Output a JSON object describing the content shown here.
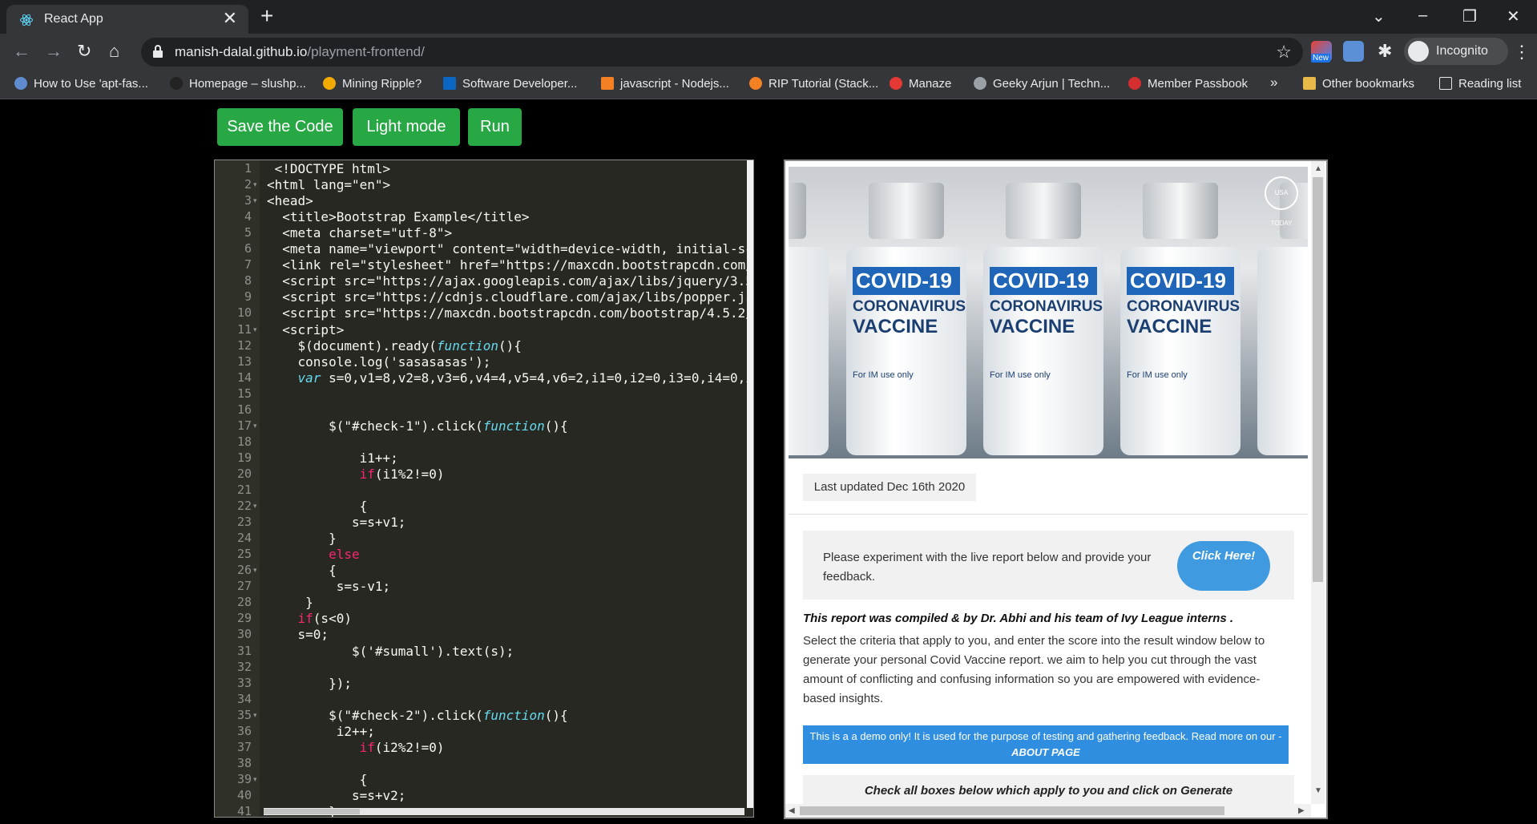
{
  "browser": {
    "tab_title": "React App",
    "url_host": "manish-dalal.github.io",
    "url_path": "/playment-frontend/",
    "incognito_label": "Incognito",
    "extension_badge": "New",
    "bookmarks": [
      "How to Use 'apt-fas...",
      "Homepage – slushp...",
      "Mining Ripple?",
      "Software Developer...",
      "javascript - Nodejs...",
      "RIP Tutorial (Stack...",
      "Manaze",
      "Geeky Arjun | Techn...",
      "Member Passbook"
    ],
    "bookmarks_overflow": "»",
    "other_bookmarks": "Other bookmarks",
    "reading_list": "Reading list"
  },
  "toolbar": {
    "save_label": "Save the Code",
    "light_label": "Light mode",
    "run_label": "Run"
  },
  "editor": {
    "line_numbers": [
      "1",
      "2",
      "3",
      "4",
      "5",
      "6",
      "7",
      "8",
      "9",
      "10",
      "11",
      "12",
      "13",
      "14",
      "15",
      "16",
      "17",
      "18",
      "19",
      "20",
      "21",
      "22",
      "23",
      "24",
      "25",
      "26",
      "27",
      "28",
      "29",
      "30",
      "31",
      "32",
      "33",
      "34",
      "35",
      "36",
      "37",
      "38",
      "39",
      "40",
      "41"
    ],
    "lines": [
      " <!DOCTYPE html>",
      "<html lang=\"en\">",
      "<head>",
      "  <title>Bootstrap Example</title>",
      "  <meta charset=\"utf-8\">",
      "  <meta name=\"viewport\" content=\"width=device-width, initial-sc",
      "  <link rel=\"stylesheet\" href=\"https://maxcdn.bootstrapcdn.com/",
      "  <script src=\"https://ajax.googleapis.com/ajax/libs/jquery/3.5",
      "  <script src=\"https://cdnjs.cloudflare.com/ajax/libs/popper.js",
      "  <script src=\"https://maxcdn.bootstrapcdn.com/bootstrap/4.5.2/",
      "  <script>",
      "    $(document).ready(function(){",
      "    console.log('sasasasas');",
      "    var s=0,v1=8,v2=8,v3=6,v4=4,v5=4,v6=2,i1=0,i2=0,i3=0,i4=0,i",
      "",
      "",
      "        $(\"#check-1\").click(function(){",
      "",
      "            i1++;",
      "            if(i1%2!=0)",
      "",
      "            {",
      "           s=s+v1;",
      "        }",
      "        else",
      "        {",
      "         s=s-v1;",
      "     }",
      "    if(s<0)",
      "    s=0;",
      "           $('#sumall').text(s);",
      "",
      "        });",
      "",
      "        $(\"#check-2\").click(function(){",
      "         i2++;",
      "            if(i2%2!=0)",
      "",
      "            {",
      "           s=s+v2;",
      "        }"
    ],
    "fold_lines": [
      2,
      3,
      11,
      17,
      22,
      26,
      35,
      39
    ]
  },
  "preview": {
    "vial_text": {
      "brand": "COVID-19",
      "line2": "CORONAVIRUS",
      "line3": "VACCINE",
      "line4": "For IM use only"
    },
    "watermark": "USA TODAY",
    "last_updated": "Last updated Dec 16th 2020",
    "feedback_text": "Please experiment with the live report below and provide your feedback.",
    "click_button": "Click Here!",
    "compiled": "This report was compiled & by Dr. Abhi and his team of Ivy League interns .",
    "description": "Select the criteria that apply to you, and enter the score into the result window below to generate your personal Covid Vaccine report. we aim to help you cut through the vast amount of conflicting and confusing information so you are empowered with evidence-based insights.",
    "demo_text": "This is a a demo only! It is used for the purpose of testing and gathering feedback. Read more on our -",
    "demo_link": "ABOUT PAGE",
    "checkbox_heading": "Check all boxes below which apply to you and click on Generate"
  },
  "colors": {
    "button_green": "#28a745",
    "editor_bg": "#272822",
    "demo_blue": "#2f8ee0"
  }
}
